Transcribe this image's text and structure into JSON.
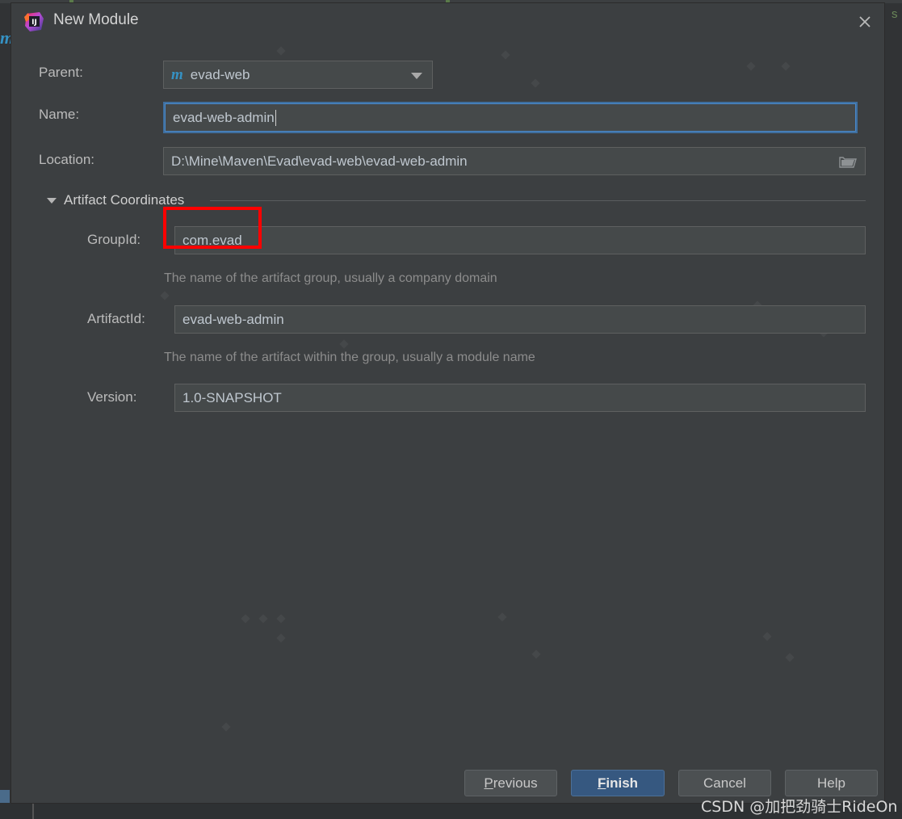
{
  "window": {
    "title": "New Module",
    "app_icon": "intellij-idea-icon",
    "close_icon": "close-icon"
  },
  "form": {
    "parent": {
      "label": "Parent:",
      "value": "evad-web",
      "icon": "maven-module-icon",
      "dropdown_icon": "chevron-down-icon"
    },
    "name": {
      "label": "Name:",
      "value": "evad-web-admin",
      "focused": true
    },
    "location": {
      "label": "Location:",
      "value": "D:\\Mine\\Maven\\Evad\\evad-web\\evad-web-admin",
      "browse_icon": "folder-icon"
    }
  },
  "artifact_section": {
    "title": "Artifact Coordinates",
    "expanded": true,
    "toggle_icon": "triangle-down-icon",
    "group_id": {
      "label": "GroupId:",
      "value": "com.evad",
      "hint": "The name of the artifact group, usually a company domain",
      "highlighted": true,
      "highlight_color": "#ff0000"
    },
    "artifact_id": {
      "label": "ArtifactId:",
      "value": "evad-web-admin",
      "hint": "The name of the artifact within the group, usually a module name"
    },
    "version": {
      "label": "Version:",
      "value": "1.0-SNAPSHOT"
    }
  },
  "footer": {
    "previous": {
      "label": "Previous",
      "mnemonic": "P"
    },
    "finish": {
      "label": "Finish",
      "mnemonic": "F",
      "primary": true
    },
    "cancel": {
      "label": "Cancel"
    },
    "help": {
      "label": "Help"
    }
  },
  "watermark": {
    "text": "CSDN @加把劲骑士RideOn"
  },
  "backdrop": {
    "maven_glyph": "m",
    "editor_glyph": "s"
  },
  "colors": {
    "dialog_bg": "#3c3f41",
    "field_bg": "#45494a",
    "accent_blue": "#365880",
    "focus_blue": "#4a88c7",
    "highlight_red": "#ff0000",
    "maven_blue": "#3592c4"
  }
}
